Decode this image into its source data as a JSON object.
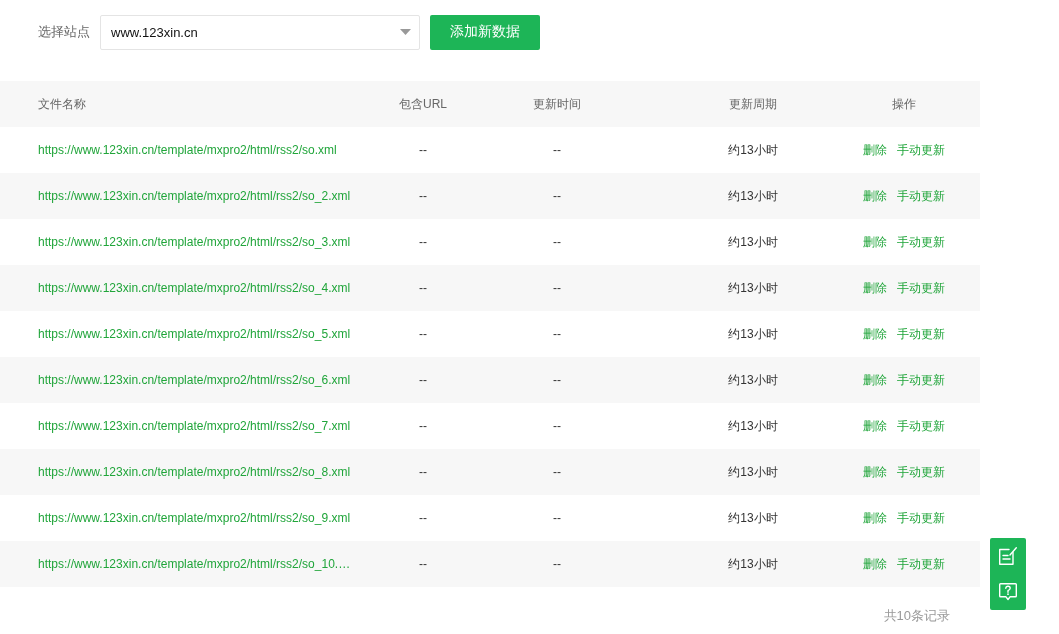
{
  "toolbar": {
    "site_label": "选择站点",
    "site_select": {
      "value": "www.123xin.cn"
    },
    "add_button": "添加新数据"
  },
  "table": {
    "columns": [
      "文件名称",
      "包含URL",
      "更新时间",
      "更新周期",
      "操作"
    ],
    "rows": [
      {
        "file_name": "https://www.123xin.cn/template/mxpro2/html/rss2/so.xml",
        "contains_url": "--",
        "updated_at": "--",
        "update_period": "约13小时",
        "actions": [
          "删除",
          "手动更新"
        ]
      },
      {
        "file_name": "https://www.123xin.cn/template/mxpro2/html/rss2/so_2.xml",
        "contains_url": "--",
        "updated_at": "--",
        "update_period": "约13小时",
        "actions": [
          "删除",
          "手动更新"
        ]
      },
      {
        "file_name": "https://www.123xin.cn/template/mxpro2/html/rss2/so_3.xml",
        "contains_url": "--",
        "updated_at": "--",
        "update_period": "约13小时",
        "actions": [
          "删除",
          "手动更新"
        ]
      },
      {
        "file_name": "https://www.123xin.cn/template/mxpro2/html/rss2/so_4.xml",
        "contains_url": "--",
        "updated_at": "--",
        "update_period": "约13小时",
        "actions": [
          "删除",
          "手动更新"
        ]
      },
      {
        "file_name": "https://www.123xin.cn/template/mxpro2/html/rss2/so_5.xml",
        "contains_url": "--",
        "updated_at": "--",
        "update_period": "约13小时",
        "actions": [
          "删除",
          "手动更新"
        ]
      },
      {
        "file_name": "https://www.123xin.cn/template/mxpro2/html/rss2/so_6.xml",
        "contains_url": "--",
        "updated_at": "--",
        "update_period": "约13小时",
        "actions": [
          "删除",
          "手动更新"
        ]
      },
      {
        "file_name": "https://www.123xin.cn/template/mxpro2/html/rss2/so_7.xml",
        "contains_url": "--",
        "updated_at": "--",
        "update_period": "约13小时",
        "actions": [
          "删除",
          "手动更新"
        ]
      },
      {
        "file_name": "https://www.123xin.cn/template/mxpro2/html/rss2/so_8.xml",
        "contains_url": "--",
        "updated_at": "--",
        "update_period": "约13小时",
        "actions": [
          "删除",
          "手动更新"
        ]
      },
      {
        "file_name": "https://www.123xin.cn/template/mxpro2/html/rss2/so_9.xml",
        "contains_url": "--",
        "updated_at": "--",
        "update_period": "约13小时",
        "actions": [
          "删除",
          "手动更新"
        ]
      },
      {
        "file_name": "https://www.123xin.cn/template/mxpro2/html/rss2/so_10.…",
        "contains_url": "--",
        "updated_at": "--",
        "update_period": "约13小时",
        "actions": [
          "删除",
          "手动更新"
        ]
      }
    ]
  },
  "footer": {
    "record_count": "共10条记录"
  }
}
